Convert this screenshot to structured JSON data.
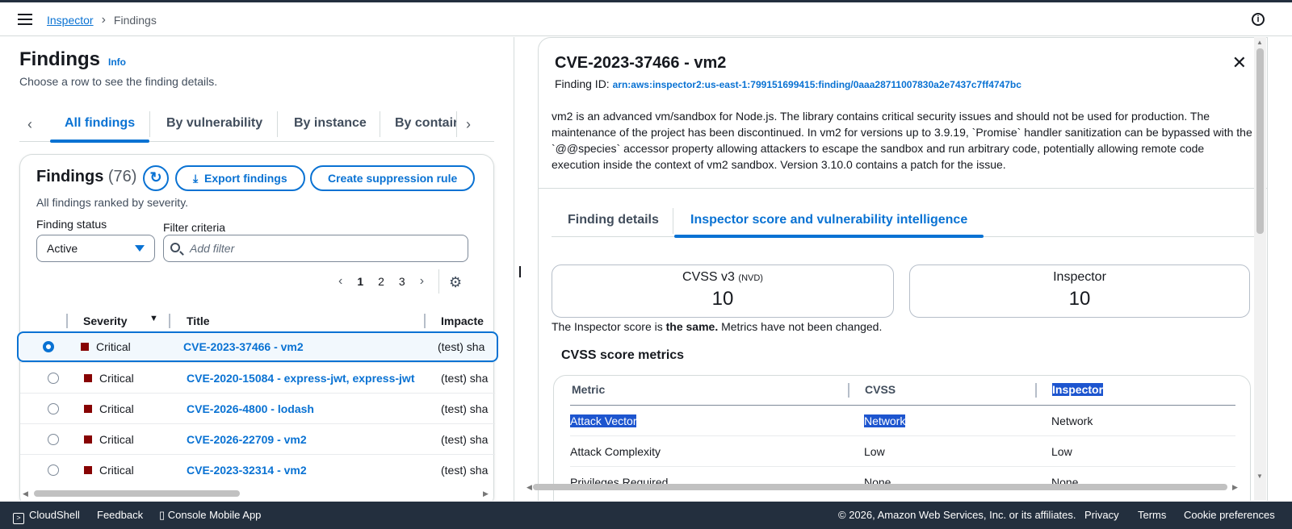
{
  "header": {
    "breadcrumb_root": "Inspector",
    "breadcrumb_current": "Findings"
  },
  "left": {
    "page_title": "Findings",
    "info_link": "Info",
    "subtitle": "Choose a row to see the finding details.",
    "tabs": [
      "All findings",
      "By vulnerability",
      "By instance",
      "By contair"
    ],
    "card": {
      "title": "Findings",
      "count": "(76)",
      "export_label": "Export findings",
      "suppress_label": "Create suppression rule",
      "description": "All findings ranked by severity.",
      "status_label": "Finding status",
      "status_value": "Active",
      "filter_label": "Filter criteria",
      "filter_placeholder": "Add filter",
      "pages": [
        "1",
        "2",
        "3"
      ],
      "columns": [
        "Severity",
        "Title",
        "Impacte"
      ],
      "rows": [
        {
          "severity": "Critical",
          "title": "CVE-2023-37466 - vm2",
          "impacted": "(test) sha"
        },
        {
          "severity": "Critical",
          "title": "CVE-2020-15084 - express-jwt, express-jwt",
          "impacted": "(test) sha"
        },
        {
          "severity": "Critical",
          "title": "CVE-2026-4800 - lodash",
          "impacted": "(test) sha"
        },
        {
          "severity": "Critical",
          "title": "CVE-2026-22709 - vm2",
          "impacted": "(test) sha"
        },
        {
          "severity": "Critical",
          "title": "CVE-2023-32314 - vm2",
          "impacted": "(test) sha"
        }
      ]
    }
  },
  "detail": {
    "title": "CVE-2023-37466 - vm2",
    "finding_id_label": "Finding ID:",
    "finding_id": "arn:aws:inspector2:us-east-1:799151699415:finding/0aaa28711007830a2e7437c7ff4747bc",
    "description": "vm2 is an advanced vm/sandbox for Node.js. The library contains critical security issues and should not be used for production. The maintenance of the project has been discontinued. In vm2 for versions up to 3.9.19, `Promise` handler sanitization can be bypassed with the `@@species` accessor property allowing attackers to escape the sandbox and run arbitrary code, potentially allowing remote code execution inside the context of vm2 sandbox. Version 3.10.0 contains a patch for the issue.",
    "tabs": [
      "Finding details",
      "Inspector score and vulnerability intelligence"
    ],
    "cvss_label": "CVSS v3",
    "cvss_source": "(NVD)",
    "cvss_score": "10",
    "inspector_label": "Inspector",
    "inspector_score": "10",
    "score_note_pre": "The Inspector score is ",
    "score_note_bold": "the same.",
    "score_note_post": " Metrics have not been changed.",
    "metrics_title": "CVSS score metrics",
    "metric_columns": [
      "Metric",
      "CVSS",
      "Inspector"
    ],
    "metrics": [
      {
        "metric": "Attack Vector",
        "cvss": "Network",
        "inspector": "Network"
      },
      {
        "metric": "Attack Complexity",
        "cvss": "Low",
        "inspector": "Low"
      },
      {
        "metric": "Privileges Required",
        "cvss": "None",
        "inspector": "None"
      }
    ]
  },
  "footer": {
    "cloudshell": "CloudShell",
    "feedback": "Feedback",
    "mobile": "Console Mobile App",
    "copyright": "© 2026, Amazon Web Services, Inc. or its affiliates.",
    "privacy": "Privacy",
    "terms": "Terms",
    "cookies": "Cookie preferences"
  },
  "colors": {
    "accent": "#0972d3",
    "critical": "#870303",
    "footer_bg": "#232f3e",
    "selection": "#1d55cf"
  }
}
